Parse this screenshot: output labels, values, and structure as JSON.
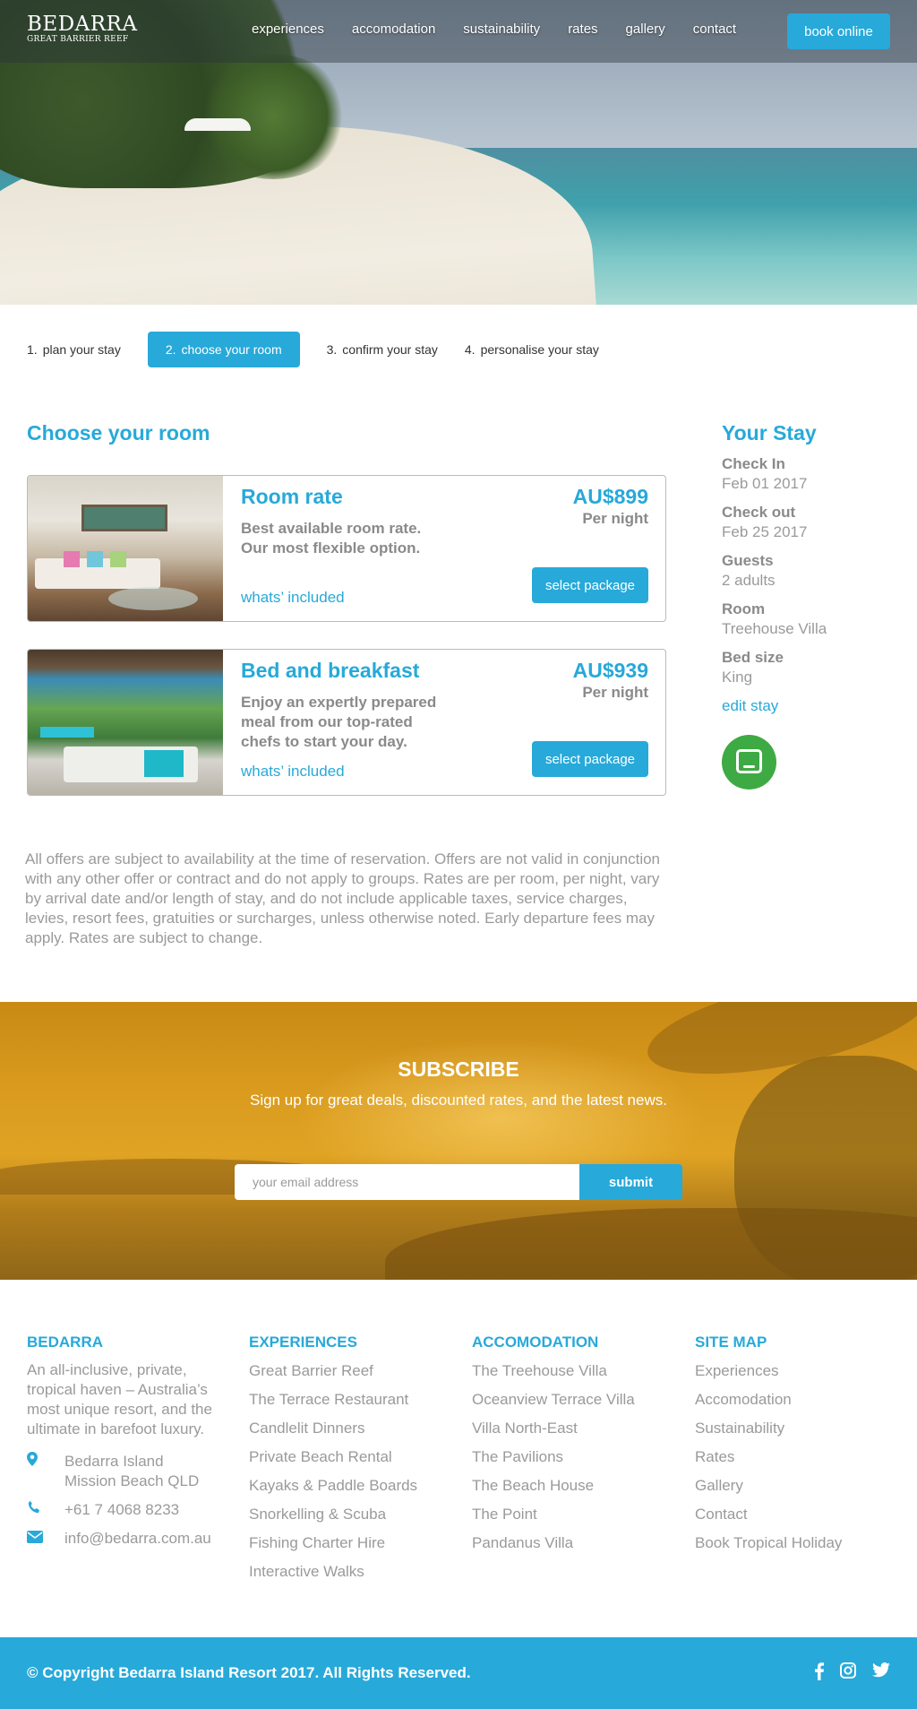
{
  "header": {
    "logo_name": "BEDARRA",
    "logo_tagline": "GREAT BARRIER REEF",
    "nav": [
      "experiences",
      "accomodation",
      "sustainability",
      "rates",
      "gallery",
      "contact"
    ],
    "book_label": "book online"
  },
  "steps": [
    {
      "num": "1.",
      "label": "plan your stay",
      "active": false
    },
    {
      "num": "2.",
      "label": "choose your room",
      "active": true
    },
    {
      "num": "3.",
      "label": "confirm your stay",
      "active": false
    },
    {
      "num": "4.",
      "label": "personalise your stay",
      "active": false
    }
  ],
  "main": {
    "title": "Choose your room",
    "packages": [
      {
        "title": "Room rate",
        "description": "Best available room rate. Our most flexible option.",
        "included_link": "whats’ included",
        "price": "AU$899",
        "per": "Per night",
        "button": "select package"
      },
      {
        "title": "Bed and breakfast",
        "description": "Enjoy an expertly prepared meal from our top-rated chefs to start your day.",
        "included_link": "whats’ included",
        "price": "AU$939",
        "per": "Per night",
        "button": "select package"
      }
    ],
    "disclaimer": "All offers are subject to availability at the time of reservation. Offers are not valid in conjunction with any other offer or contract and do not apply to groups. Rates are per room, per night, vary by arrival date and/or length of stay, and do not include applicable taxes, service charges, levies, resort fees, gratuities or surcharges, unless otherwise noted. Early departure fees may apply. Rates are subject to change."
  },
  "sidebar": {
    "title": "Your Stay",
    "items": [
      {
        "label": "Check In",
        "value": "Feb 01 2017"
      },
      {
        "label": "Check out",
        "value": "Feb 25 2017"
      },
      {
        "label": "Guests",
        "value": "2 adults"
      },
      {
        "label": "Room",
        "value": "Treehouse Villa"
      },
      {
        "label": "Bed size",
        "value": "King"
      }
    ],
    "edit_label": "edit stay"
  },
  "subscribe": {
    "title": "SUBSCRIBE",
    "subtitle": "Sign up for great deals, discounted rates, and the latest news.",
    "placeholder": "your email address",
    "submit": "submit"
  },
  "footer": {
    "about_title": "BEDARRA",
    "about_text": "An all-inclusive, private, tropical haven – Australia’s most unique resort, and the ultimate in barefoot luxury.",
    "address": [
      "Bedarra Island",
      "Mission Beach QLD"
    ],
    "phone": "+61 7 4068 8233",
    "email": "info@bedarra.com.au",
    "experiences_title": "EXPERIENCES",
    "experiences": [
      "Great Barrier Reef",
      "The Terrace Restaurant",
      "Candlelit Dinners",
      "Private Beach Rental",
      "Kayaks & Paddle Boards",
      "Snorkelling & Scuba",
      "Fishing Charter Hire",
      "Interactive Walks"
    ],
    "accomodation_title": "ACCOMODATION",
    "accomodation": [
      "The Treehouse Villa",
      "Oceanview Terrace Villa",
      "Villa North-East",
      "The Pavilions",
      "The Beach House",
      "The Point",
      "Pandanus Villa"
    ],
    "sitemap_title": "SITE MAP",
    "sitemap": [
      "Experiences",
      "Accomodation",
      "Sustainability",
      "Rates",
      "Gallery",
      "Contact",
      "Book Tropical Holiday"
    ],
    "copyright": "© Copyright Bedarra Island Resort 2017. All Rights Reserved.",
    "social_icons": [
      "facebook-icon",
      "instagram-icon",
      "twitter-icon"
    ]
  },
  "colors": {
    "accent": "#27a9d9",
    "text": "#8a8a8a",
    "chat": "#3eaa43"
  }
}
